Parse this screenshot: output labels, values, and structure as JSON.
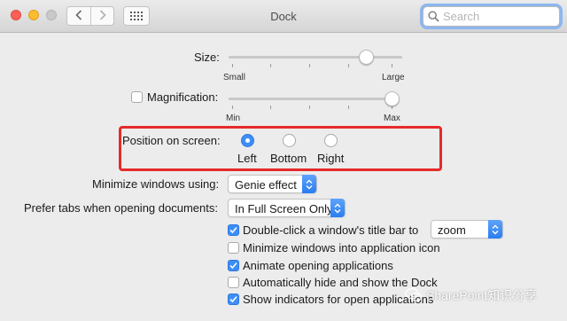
{
  "window": {
    "title": "Dock"
  },
  "search": {
    "placeholder": "Search"
  },
  "size": {
    "label": "Size:",
    "min_label": "Small",
    "max_label": "Large",
    "value": 0.86
  },
  "magnification": {
    "label": "Magnification:",
    "checked": false,
    "min_label": "Min",
    "max_label": "Max",
    "value": 1.0
  },
  "position": {
    "label": "Position on screen:",
    "options": [
      "Left",
      "Bottom",
      "Right"
    ],
    "selected": "Left"
  },
  "minimize": {
    "label": "Minimize windows using:",
    "value": "Genie effect"
  },
  "tabs_pref": {
    "label": "Prefer tabs when opening documents:",
    "value": "In Full Screen Only"
  },
  "double_click": {
    "label": "Double-click a window's title bar to",
    "value": "zoom",
    "checked": true
  },
  "checkboxes": [
    {
      "label": "Minimize windows into application icon",
      "checked": false
    },
    {
      "label": "Animate opening applications",
      "checked": true
    },
    {
      "label": "Automatically hide and show the Dock",
      "checked": false
    },
    {
      "label": "Show indicators for open applications",
      "checked": true
    }
  ],
  "watermark": {
    "text": "SharePoint知识分享"
  },
  "colors": {
    "accent": "#3d8ef7",
    "highlight_box": "#e52a2a"
  },
  "icons": [
    "back-icon",
    "forward-icon",
    "grid-icon",
    "search-icon",
    "checkmark-icon",
    "updown-arrows-icon",
    "wechat-icon"
  ]
}
